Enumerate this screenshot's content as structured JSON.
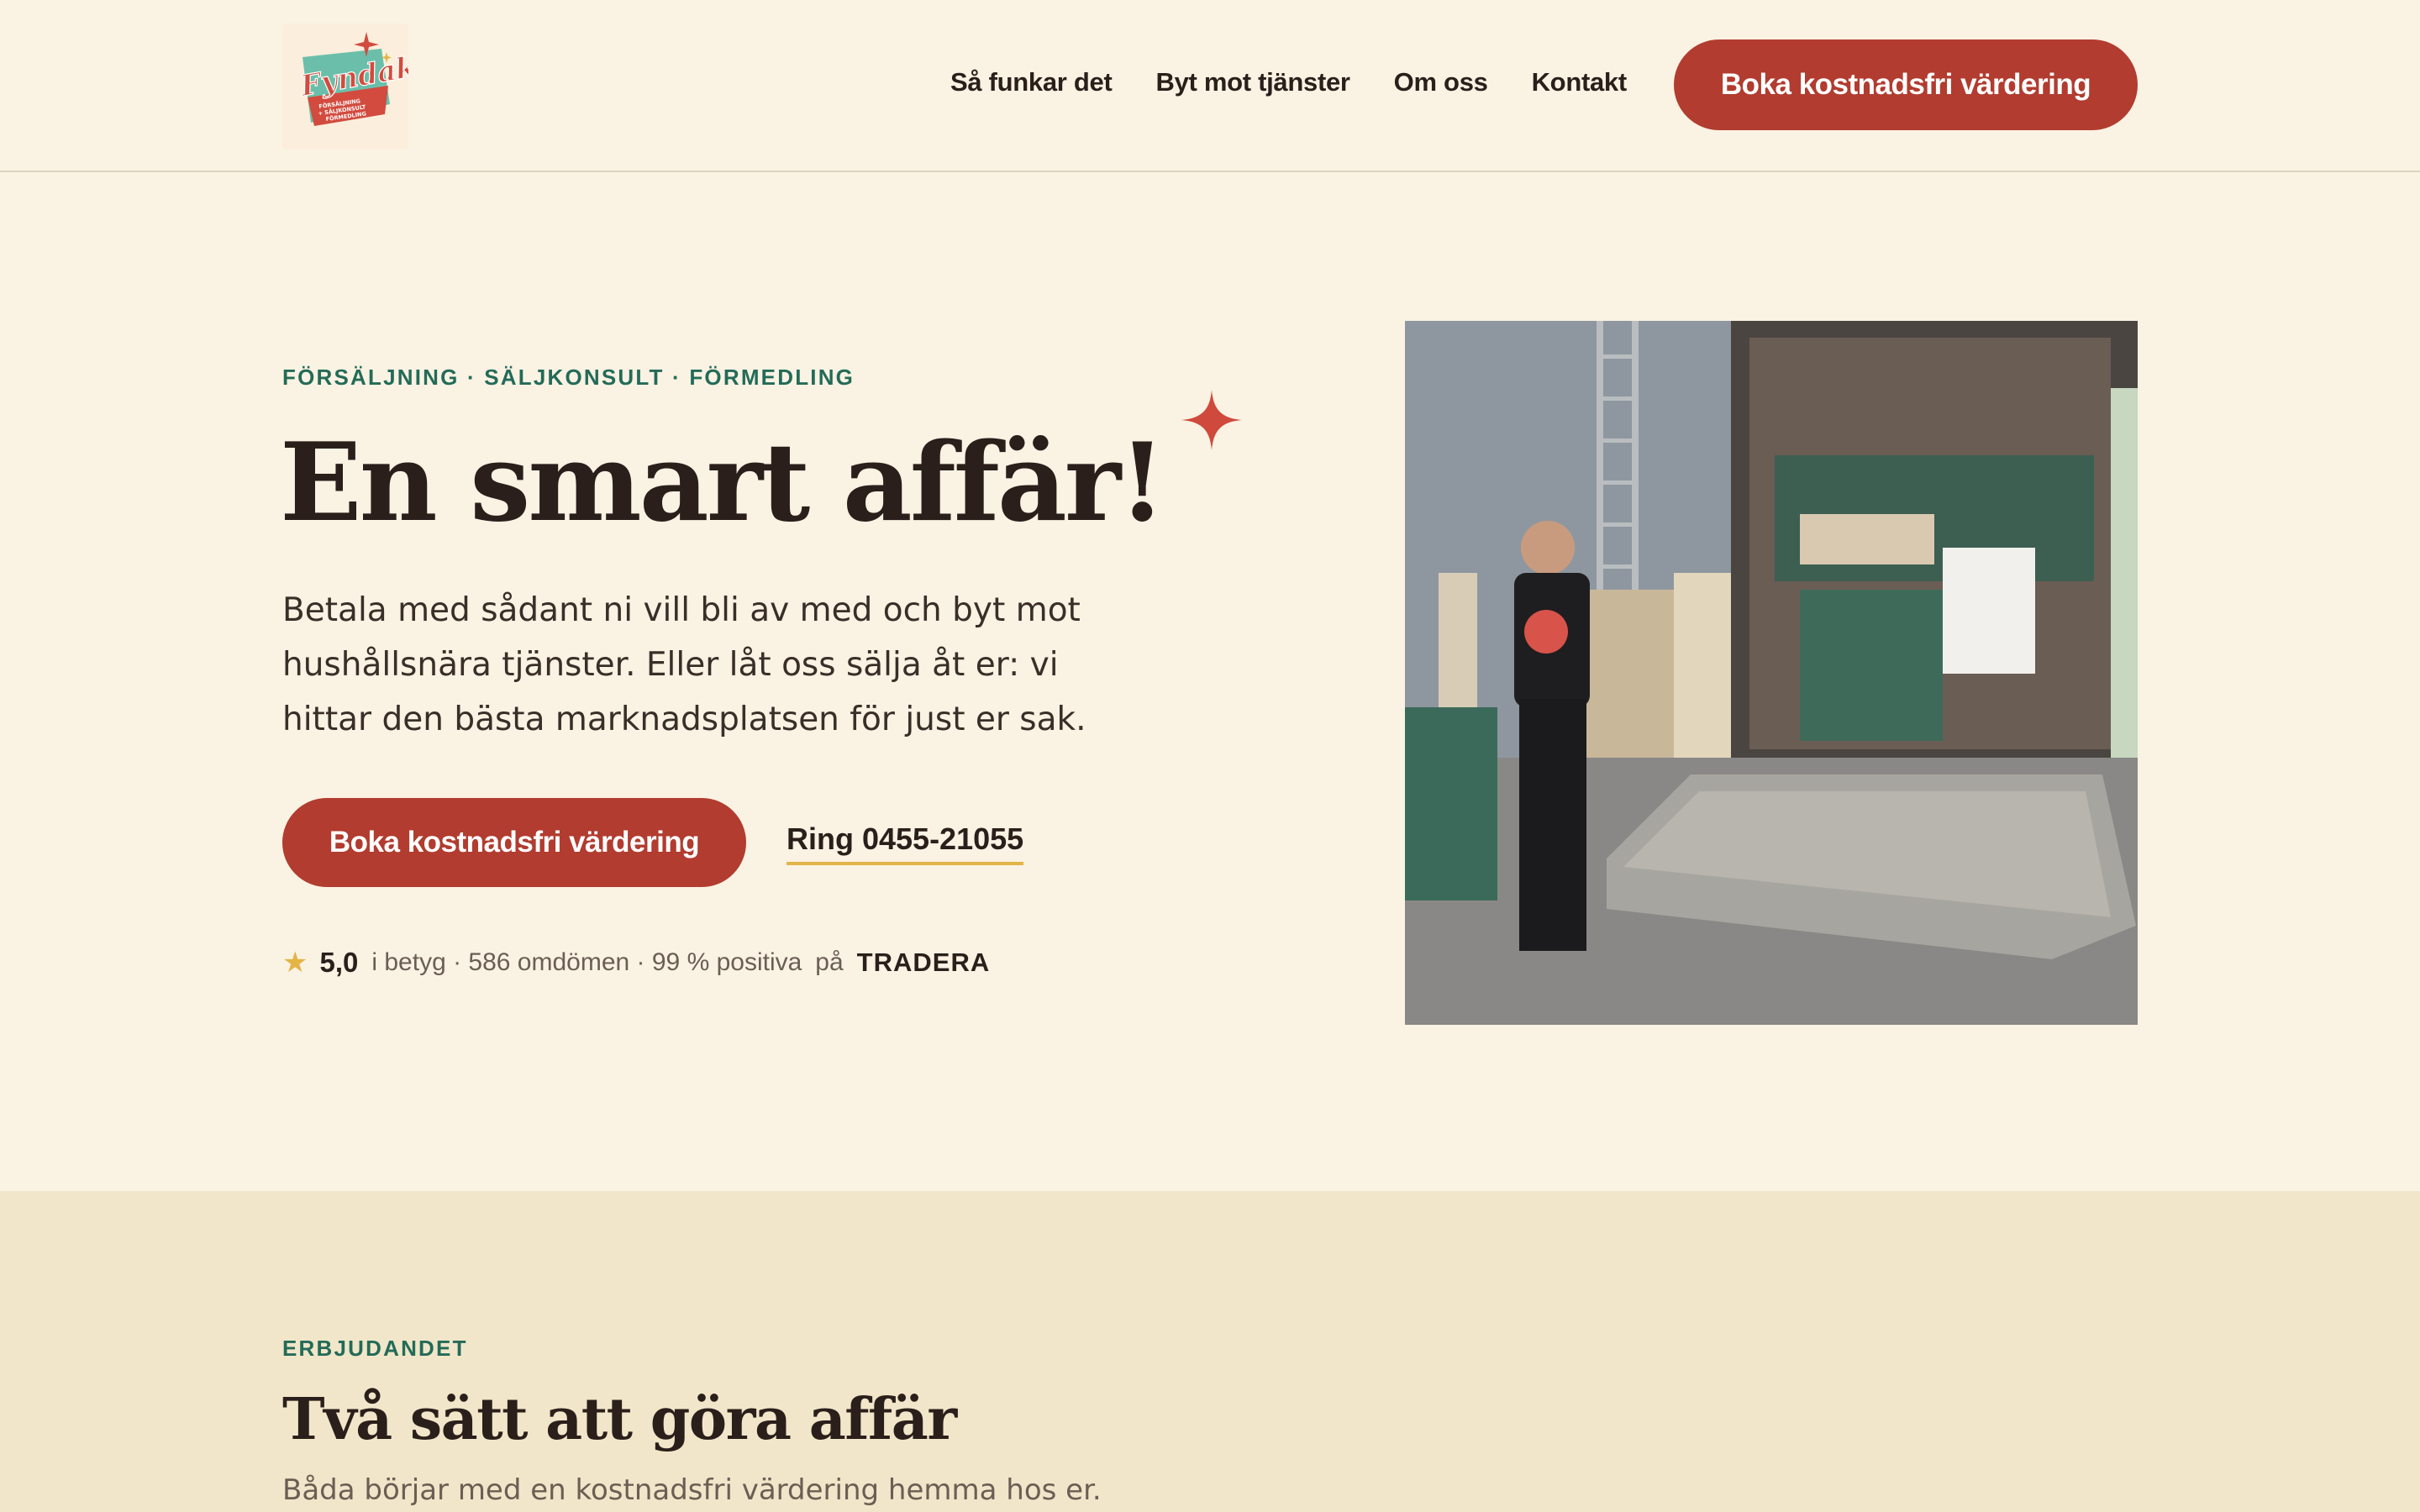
{
  "brand": {
    "logo_name": "Fyndak",
    "logo_tagline": [
      "FÖRSÄLJNING",
      "+ SÄLJKONSULT",
      "FÖRMEDLING"
    ]
  },
  "nav": {
    "items": [
      {
        "label": "Så funkar det"
      },
      {
        "label": "Byt mot tjänster"
      },
      {
        "label": "Om oss"
      },
      {
        "label": "Kontakt"
      }
    ],
    "cta_label": "Boka kostnadsfri värdering"
  },
  "hero": {
    "eyebrow": "FÖRSÄLJNING · SÄLJKONSULT · FÖRMEDLING",
    "title": "En smart affär!",
    "text": "Betala med sådant ni vill bli av med och byt mot hushållsnära tjänster. Eller låt oss sälja åt er: vi hittar den bästa marknadsplatsen för just er sak.",
    "cta_label": "Boka kostnadsfri värdering",
    "phone_label": "Ring 0455-21055",
    "rating": {
      "score": "5,0",
      "meta": "i betyg · 586 omdömen · 99 % positiva",
      "on": "på",
      "platform": "TRADERA"
    }
  },
  "offer": {
    "eyebrow": "ERBJUDANDET",
    "title": "Två sätt att göra affär",
    "subtitle": "Båda börjar med en kostnadsfri värdering hemma hos er."
  },
  "colors": {
    "background": "#faf2e3",
    "accent_red": "#b13c2f",
    "accent_green": "#236b58",
    "underline_gold": "#e3b446",
    "section_band": "#f1e6c9"
  }
}
